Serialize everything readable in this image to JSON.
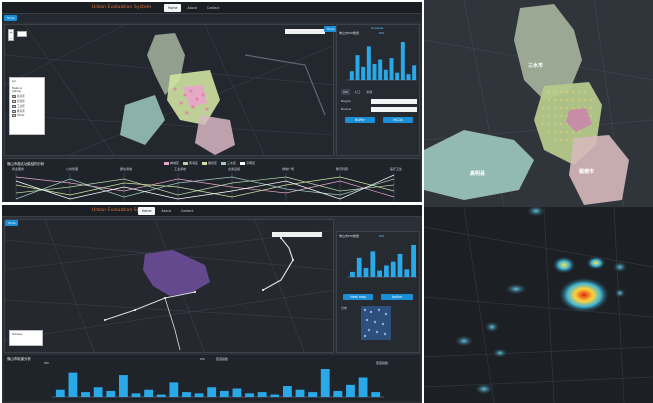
{
  "app": {
    "brand": "Urban Evaluation System",
    "nav_tabs": [
      "Home",
      "About",
      "Contact"
    ],
    "active_tab": "Home"
  },
  "top_view": {
    "tool_chip": "Tools",
    "map_zoom": {
      "plus": "+",
      "minus": "−"
    },
    "legend": {
      "header": "poi",
      "section": "Feature",
      "subheader": "(Value)",
      "items": [
        {
          "label": "商业区",
          "color": "#e7a6c8"
        },
        {
          "label": "居住区",
          "color": "#cfe3a1"
        },
        {
          "label": "工业区",
          "color": "#9fc9c0"
        },
        {
          "label": "教育区",
          "color": "#d4c5e8"
        },
        {
          "label": "Other",
          "color": "#f1d2a6"
        }
      ]
    },
    "side_panel": {
      "heading": "Analysis",
      "chart_title": "佛山市POI数量",
      "legend": "POI",
      "mode_tabs": [
        "POI",
        "人口",
        "交通"
      ],
      "field_label_1": "Region",
      "field_label_2": "Radius",
      "buttons": [
        "Buffer",
        "MCDA"
      ]
    },
    "parallel": {
      "title": "佛山市各区功能结构分析",
      "legend": [
        {
          "label": "禅城区",
          "color": "#e7a6c8"
        },
        {
          "label": "南海区",
          "color": "#b3d6a8"
        },
        {
          "label": "顺德区",
          "color": "#cfe3a1"
        },
        {
          "label": "三水区",
          "color": "#9fc9c0"
        },
        {
          "label": "高明区",
          "color": "#ffffff"
        }
      ],
      "axes": [
        "商业服务",
        "公共管理",
        "居住用地",
        "工业用地",
        "交通设施",
        "绿地广场",
        "教育科研",
        "医疗卫生"
      ]
    }
  },
  "bottom_view": {
    "tool_chip": "Tools",
    "map_legend": "Subway",
    "side_panel": {
      "chart_title": "佛山市POI数量",
      "legend": "POI",
      "buttons": [
        "Heat map",
        "Isoline"
      ],
      "grid_label": "分布"
    },
    "bar_chart": {
      "title": "佛山市街道分析",
      "legend": [
        "POI",
        "密度指数"
      ],
      "ylabel": "POI",
      "right_label": "密度指数"
    }
  },
  "right_upper": {
    "districts": [
      "三水市",
      "高明县",
      "顺德市"
    ]
  },
  "chart_data": [
    {
      "type": "bar",
      "title": "佛山市POI数量",
      "categories": [
        "禅城区",
        "南海区",
        "顺德区",
        "三水区",
        "高明区"
      ],
      "series": [
        {
          "name": "POI",
          "values": [
            12,
            34,
            18,
            46,
            22,
            28,
            14,
            30,
            10,
            52,
            8,
            20
          ]
        }
      ]
    },
    {
      "type": "bar",
      "title": "佛山市POI数量",
      "series": [
        {
          "name": "POI",
          "values": [
            8,
            30,
            14,
            40,
            10,
            18,
            24,
            36,
            12,
            50
          ]
        }
      ]
    },
    {
      "type": "bar",
      "title": "佛山市街道分析",
      "series": [
        {
          "name": "POI",
          "values": [
            6,
            20,
            4,
            8,
            5,
            18,
            3,
            6,
            2,
            12,
            4,
            3,
            8,
            5,
            7,
            3,
            4,
            2,
            9,
            6,
            4,
            23,
            5,
            10,
            16,
            4
          ]
        }
      ]
    }
  ]
}
